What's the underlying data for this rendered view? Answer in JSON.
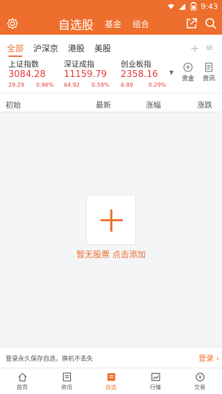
{
  "status": {
    "time": "9:43"
  },
  "header": {
    "title": "自选股",
    "tabs": [
      "基金",
      "组合"
    ]
  },
  "subtabs": [
    "全部",
    "沪深京",
    "港股",
    "美股"
  ],
  "indices": [
    {
      "name": "上证指数",
      "price": "3084.28",
      "change": "29.29",
      "pct": "0.96%"
    },
    {
      "name": "深证成指",
      "price": "11159.79",
      "change": "64.92",
      "pct": "0.59%"
    },
    {
      "name": "创业板指",
      "price": "2358.16",
      "change": "6.89",
      "pct": "0.29%"
    }
  ],
  "side_buttons": {
    "fund": "资金",
    "news": "资讯"
  },
  "columns": {
    "name": "初始",
    "latest": "最新",
    "change_pct": "涨幅",
    "change": "涨跌"
  },
  "empty": {
    "prompt": "暂无股票",
    "action": "点击添加"
  },
  "login_bar": {
    "message": "登录永久保存自选，换机不丢失",
    "link": "登录"
  },
  "bottom_nav": [
    {
      "label": "首页",
      "icon": "home-icon"
    },
    {
      "label": "资讯",
      "icon": "news-icon"
    },
    {
      "label": "自选",
      "icon": "watchlist-icon"
    },
    {
      "label": "行情",
      "icon": "market-icon"
    },
    {
      "label": "交易",
      "icon": "trade-icon"
    }
  ],
  "colors": {
    "accent": "#ee6f2d",
    "rise": "#e4393c"
  }
}
